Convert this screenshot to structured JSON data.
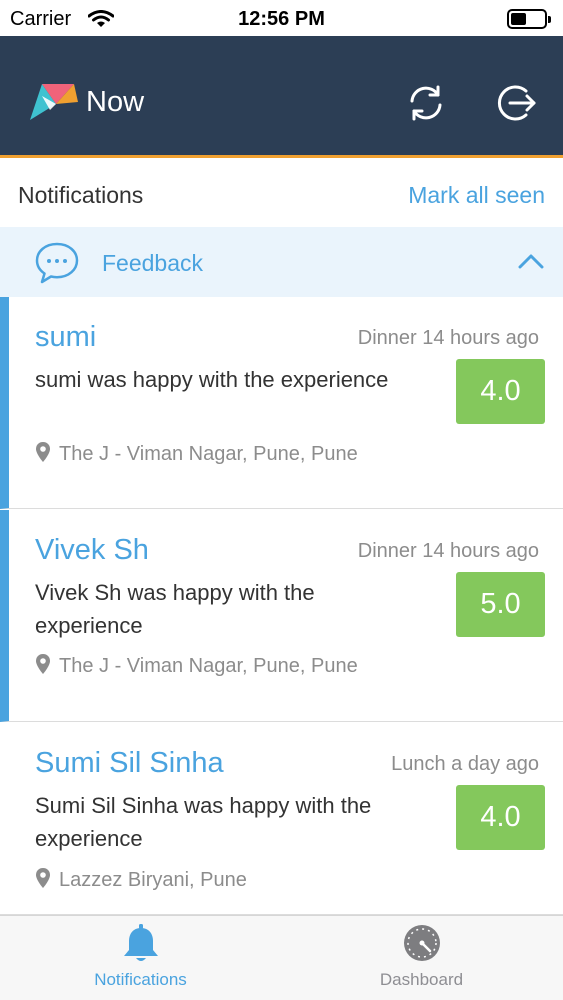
{
  "status_bar": {
    "carrier": "Carrier",
    "time": "12:56 PM"
  },
  "header": {
    "app_name": "Now",
    "icons": [
      "sync-icon",
      "logout-icon"
    ],
    "background": "#2c3e55",
    "accent": "#f0a030"
  },
  "notifications": {
    "title": "Notifications",
    "mark_all_label": "Mark all seen"
  },
  "section": {
    "label": "Feedback",
    "icon": "chat-bubble-icon",
    "expanded": true
  },
  "items": [
    {
      "name": "sumi",
      "meta": "Dinner 14 hours ago",
      "message": "sumi was happy with the experience",
      "rating": "4.0",
      "location": "The J - Viman Nagar, Pune, Pune",
      "unseen": true
    },
    {
      "name": "Vivek Sh",
      "meta": "Dinner 14 hours ago",
      "message": "Vivek Sh was happy with the experience",
      "rating": "5.0",
      "location": "The J - Viman Nagar, Pune, Pune",
      "unseen": true
    },
    {
      "name": "Sumi Sil Sinha",
      "meta": "Lunch a day ago",
      "message": "Sumi Sil Sinha was happy with the experience",
      "rating": "4.0",
      "location": "Lazzez Biryani, Pune",
      "unseen": false
    }
  ],
  "tabs": [
    {
      "label": "Notifications",
      "icon": "bell-icon",
      "active": true
    },
    {
      "label": "Dashboard",
      "icon": "dashboard-gauge-icon",
      "active": false
    }
  ],
  "colors": {
    "link_blue": "#4aa3df",
    "rating_green": "#84c85c",
    "muted_gray": "#8c8c8c"
  }
}
